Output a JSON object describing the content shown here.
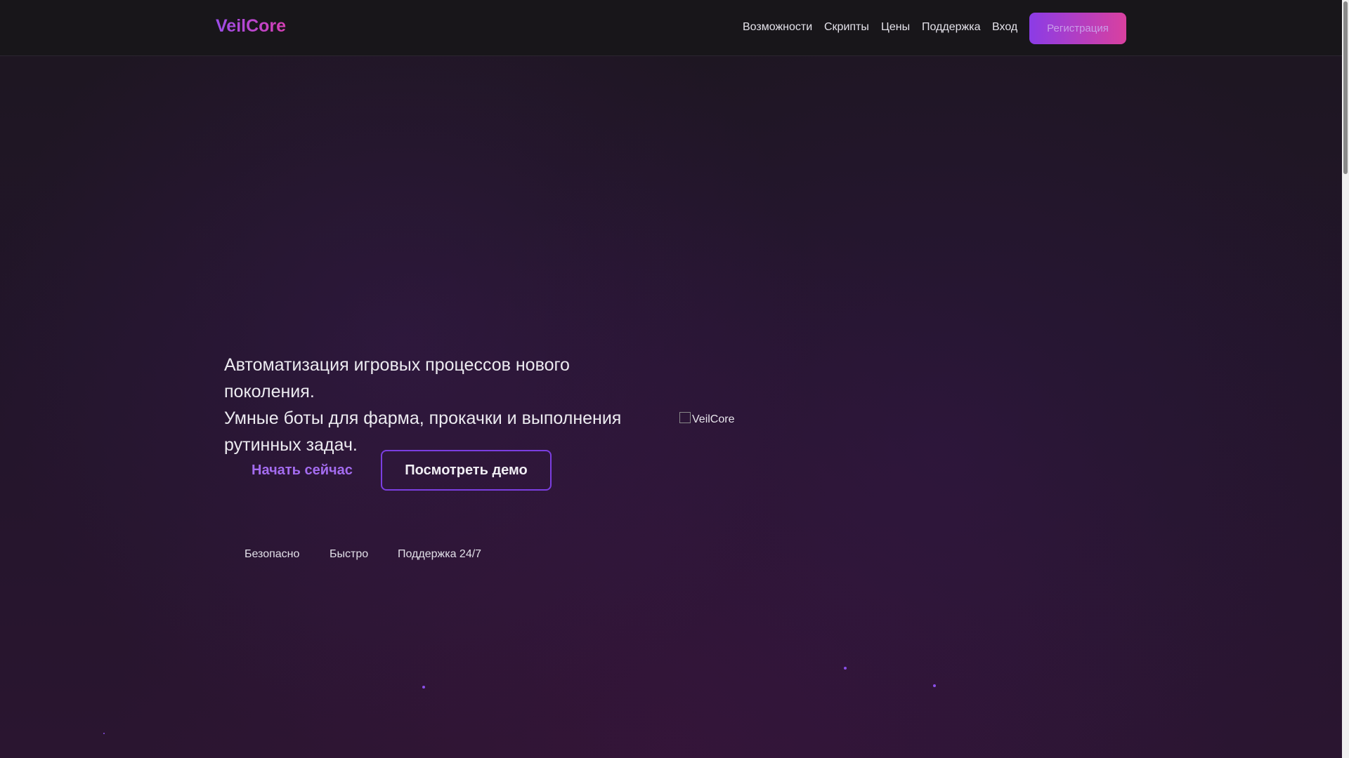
{
  "header": {
    "logo": "VeilCore",
    "nav": [
      "Возможности",
      "Скрипты",
      "Цены",
      "Поддержка",
      "Вход"
    ],
    "register_label": "Регистрация"
  },
  "hero": {
    "lines": [
      "Автоматизация игровых процессов нового поколения.",
      "Умные боты для фарма, прокачки и выполнения",
      "рутинных задач."
    ],
    "start_label": "Начать сейчас",
    "demo_label": "Посмотреть демо",
    "image_alt": "VeilCore",
    "features": [
      "Безопасно",
      "Быстро",
      "Поддержка 24/7"
    ]
  },
  "colors": {
    "accent": "#8b3ce6",
    "accent_pink": "#d9409f",
    "background": "#1d1620"
  },
  "icons": [
    "broken-image-icon"
  ]
}
